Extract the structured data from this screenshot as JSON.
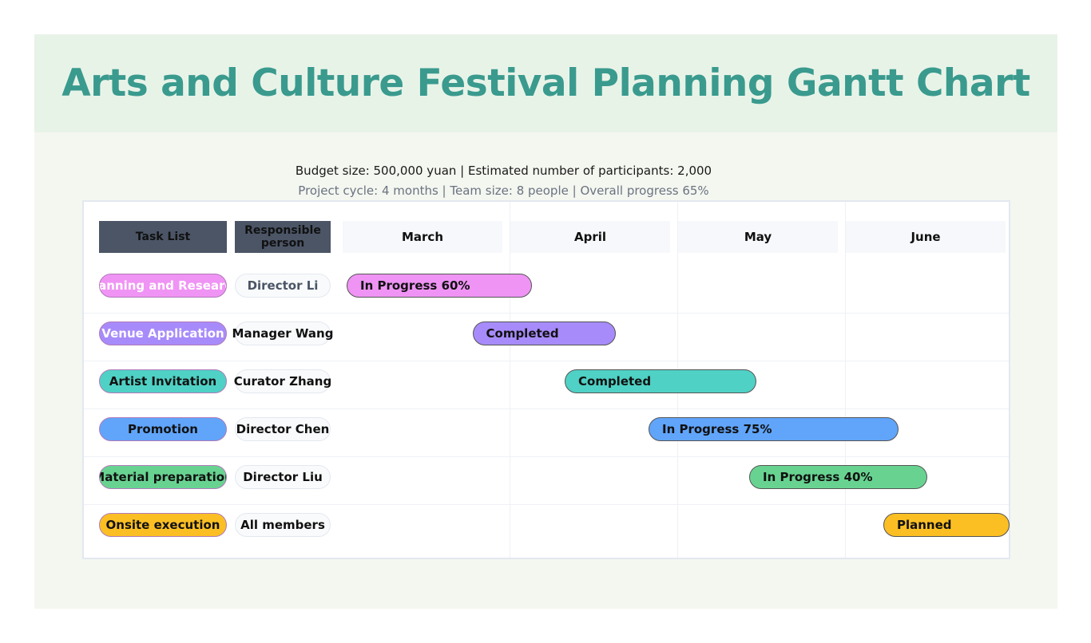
{
  "title": "Arts and Culture Festival Planning Gantt Chart",
  "subtitle_1": "Budget size: 500,000 yuan | Estimated number of participants: 2,000",
  "subtitle_2": "Project cycle: 4 months | Team size: 8 people | Overall progress 65%",
  "headers": {
    "tasks": "Task List",
    "person": "Responsible person"
  },
  "months": [
    "March",
    "April",
    "May",
    "June"
  ],
  "chart_data": {
    "type": "gantt",
    "x_unit": "month",
    "x_range": [
      0,
      4
    ],
    "tasks": [
      {
        "task": "Planning and Research",
        "person": "Director Li",
        "start": 0.0,
        "end": 1.15,
        "status": "In Progress 60%",
        "color": "#ef94f4",
        "task_text_color": "#ffffff",
        "person_text_color": "#4b5566"
      },
      {
        "task": "Venue Application",
        "person": "Manager Wang",
        "start": 0.75,
        "end": 1.65,
        "status": "Completed",
        "color": "#a78bfa",
        "task_text_color": "#ffffff",
        "person_text_color": "#111111"
      },
      {
        "task": "Artist Invitation",
        "person": "Curator Zhang",
        "start": 1.3,
        "end": 2.49,
        "status": "Completed",
        "color": "#4fd1c5",
        "task_text_color": "#111111",
        "person_text_color": "#111111"
      },
      {
        "task": "Promotion",
        "person": "Director Chen",
        "start": 1.8,
        "end": 3.34,
        "status": "In Progress 75%",
        "color": "#60a5fa",
        "task_text_color": "#111111",
        "person_text_color": "#111111"
      },
      {
        "task": "Material preparation",
        "person": "Director Liu",
        "start": 2.4,
        "end": 3.51,
        "status": "In Progress 40%",
        "color": "#68d391",
        "task_text_color": "#111111",
        "person_text_color": "#111111"
      },
      {
        "task": "Onsite execution",
        "person": "All members",
        "start": 3.2,
        "end": 4.0,
        "status": "Planned",
        "color": "#fbbf24",
        "task_text_color": "#111111",
        "person_text_color": "#111111"
      }
    ]
  }
}
